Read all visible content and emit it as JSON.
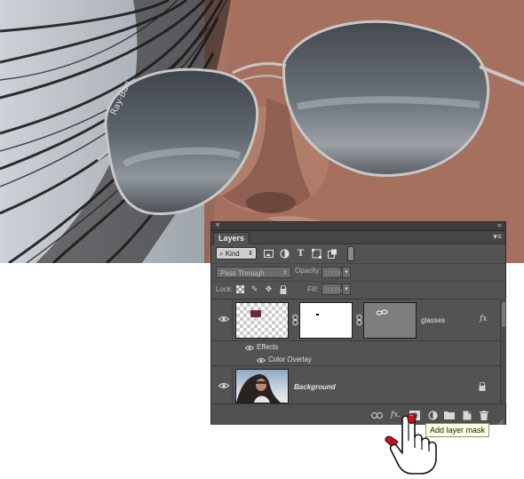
{
  "panel": {
    "tab_label": "Layers",
    "close_glyph": "×",
    "collapse_glyph": "«",
    "menu_glyph": "▾≡"
  },
  "filter": {
    "kind_label": "Kind",
    "kind_arrow": "⇕",
    "icons": [
      "image-filter-icon",
      "adjustment-filter-icon",
      "type-filter-icon",
      "shape-filter-icon",
      "smart-object-filter-icon"
    ]
  },
  "blend": {
    "mode": "Pass Through",
    "opacity_label": "Opacity:",
    "opacity_value": "100%"
  },
  "lock": {
    "label": "Lock:",
    "fill_label": "Fill:",
    "fill_value": "100%"
  },
  "layers": [
    {
      "name": "glasses",
      "effects_label": "Effects",
      "effect_item": "Color Overlay",
      "fx": "fx"
    },
    {
      "name": "Background",
      "locked": true
    }
  ],
  "bottom_bar": {
    "fx_label": "fx.",
    "icons": [
      "link-layers-icon",
      "add-layer-style-icon",
      "add-layer-mask-icon",
      "new-fill-adjustment-icon",
      "new-group-icon",
      "new-layer-icon",
      "delete-layer-icon"
    ]
  },
  "tooltip": {
    "text": "Add layer mask"
  },
  "colors": {
    "panel_bg": "#535353",
    "tooltip_bg": "#ffffe1",
    "hand_accent": "#c0141c"
  }
}
